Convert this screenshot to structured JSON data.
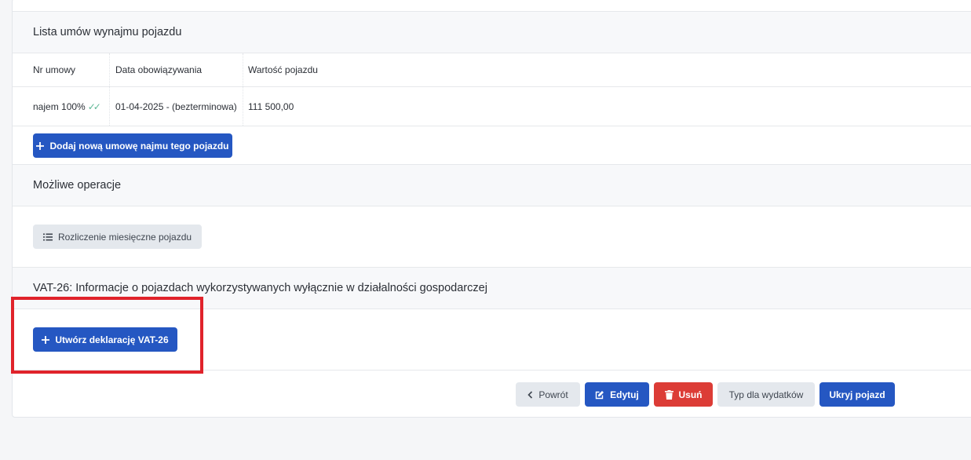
{
  "contracts": {
    "title": "Lista umów wynajmu pojazdu",
    "columns": [
      "Nr umowy",
      "Data obowiązywania",
      "Wartość pojazdu"
    ],
    "rows": [
      {
        "number": "najem 100%",
        "dates": "01-04-2025 - (bezterminowa)",
        "value": "111 500,00",
        "status": "double-check-icon"
      }
    ],
    "add_label": "Dodaj nową umowę najmu tego pojazdu"
  },
  "operations": {
    "title": "Możliwe operacje",
    "settlement_label": "Rozliczenie miesięczne pojazdu"
  },
  "vat26": {
    "title": "VAT-26: Informacje o pojazdach wykorzystywanych wyłącznie w działalności gospodarczej",
    "create_label": "Utwórz deklarację VAT-26"
  },
  "actions": {
    "back": "Powrót",
    "edit": "Edytuj",
    "delete": "Usuń",
    "expense_type": "Typ dla wydatków",
    "hide": "Ukryj pojazd"
  },
  "colors": {
    "primary": "#2557c2",
    "danger": "#dc3c36",
    "light": "#e4e8ed",
    "highlight": "#e0232b",
    "check": "#5fb896"
  }
}
